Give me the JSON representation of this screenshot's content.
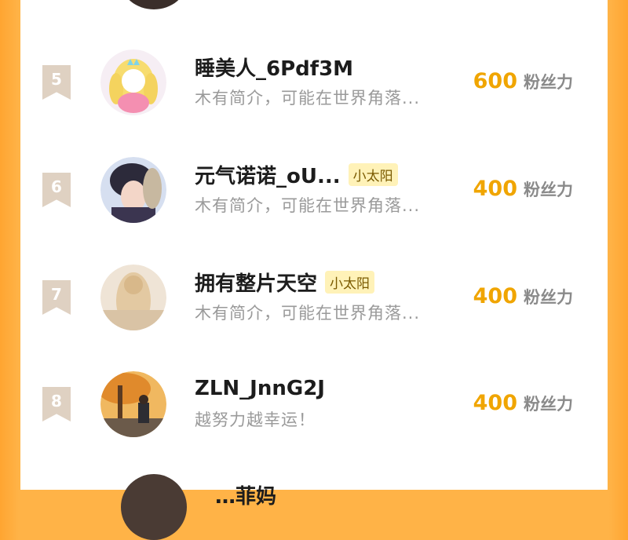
{
  "list": {
    "rows": [
      {
        "rank": "5",
        "name": "睡美人_6Pdf3M",
        "badge": "",
        "bio": "木有简介，可能在世界角落...",
        "fans_count": "600",
        "fans_unit": "粉丝力",
        "avatar_icon": "princess-cartoon-avatar-icon"
      },
      {
        "rank": "6",
        "name": "元气诺诺_oU...",
        "badge": "小太阳",
        "bio": "木有简介，可能在世界角落...",
        "fans_count": "400",
        "fans_unit": "粉丝力",
        "avatar_icon": "anime-boy-avatar-icon"
      },
      {
        "rank": "7",
        "name": "拥有整片天空",
        "badge": "小太阳",
        "bio": "木有简介，可能在世界角落...",
        "fans_count": "400",
        "fans_unit": "粉丝力",
        "avatar_icon": "blonde-hair-avatar-icon"
      },
      {
        "rank": "8",
        "name": "ZLN_JnnG2J",
        "badge": "",
        "bio": "越努力越幸运！",
        "fans_count": "400",
        "fans_unit": "粉丝力",
        "avatar_icon": "autumn-scene-avatar-icon"
      }
    ],
    "partial_next_name": "…菲妈"
  },
  "colors": {
    "accent": "#f0a500",
    "badge_bg": "#fff2b8",
    "rank_bg": "#dfd1c2",
    "frame": "#ffb347"
  }
}
